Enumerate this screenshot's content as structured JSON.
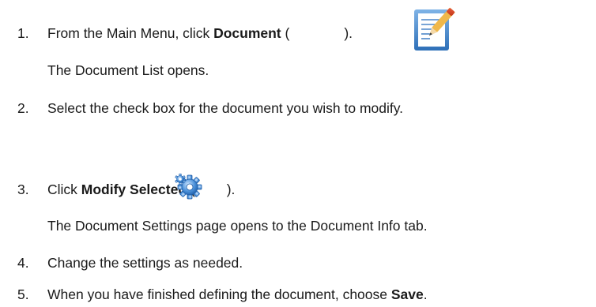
{
  "steps": [
    {
      "number": "1.",
      "before": "From the Main Menu, click ",
      "bold": "Document",
      "paren_open": " (",
      "icon": "document-edit-icon",
      "paren_close": ")."
    },
    {
      "result": "The Document List opens."
    },
    {
      "number": "2.",
      "text": "Select the check box for the document you wish to modify."
    },
    {
      "number": "3.",
      "before": "Click ",
      "bold": "Modify Selected",
      "paren_open": " (",
      "icon": "gear-icon",
      "paren_close": ")."
    },
    {
      "result": "The Document Settings page opens to the Document Info tab."
    },
    {
      "number": "4.",
      "text": "Change the settings as needed."
    },
    {
      "number": "5.",
      "before": "When you have finished defining the document, choose ",
      "bold": "Save",
      "after": "."
    }
  ]
}
